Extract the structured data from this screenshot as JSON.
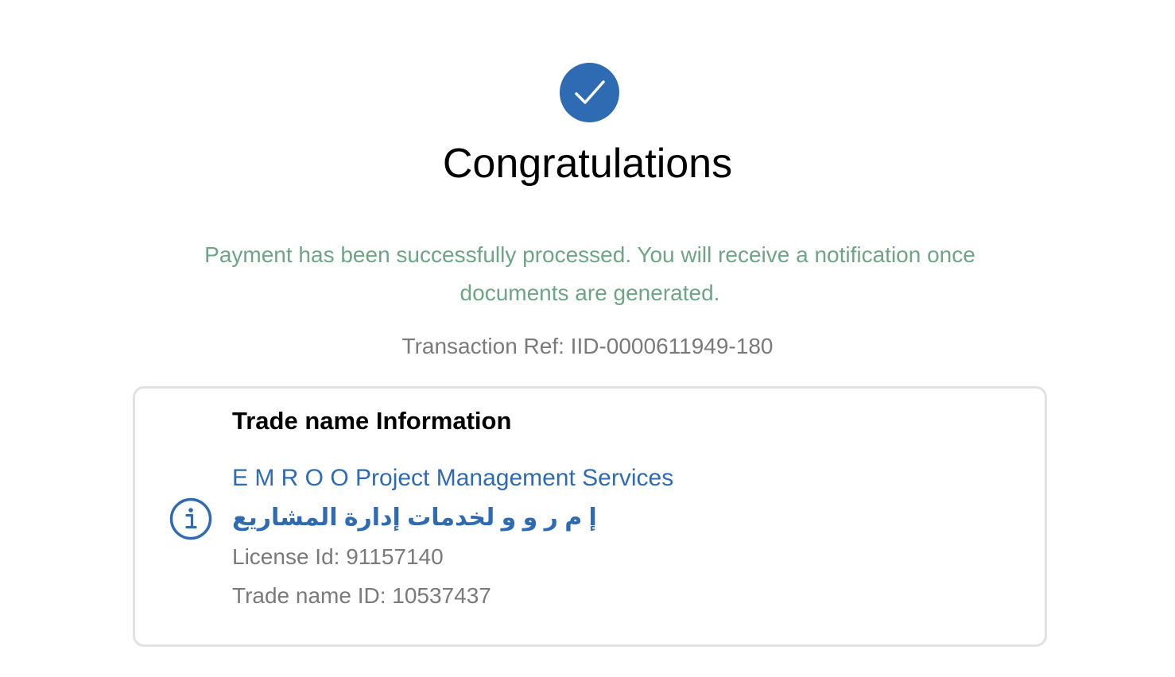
{
  "header": {
    "icon": "check-circle-icon",
    "title": "Congratulations",
    "message": "Payment has been successfully processed. You will receive a notification once documents are generated.",
    "transaction_ref": "Transaction Ref: IID-0000611949-180"
  },
  "trade_card": {
    "icon": "info-icon",
    "title": "Trade name Information",
    "name_en": "E M R O O Project Management Services",
    "name_ar": "إ م ر و و لخدمات إدارة المشاريع",
    "license_id": "License Id: 91157140",
    "trade_name_id": "Trade name ID: 10537437"
  },
  "colors": {
    "accent": "#2f6bb3",
    "success_text": "#6ea585",
    "muted_text": "#7a7a7a",
    "card_border": "#e2e2e2"
  }
}
